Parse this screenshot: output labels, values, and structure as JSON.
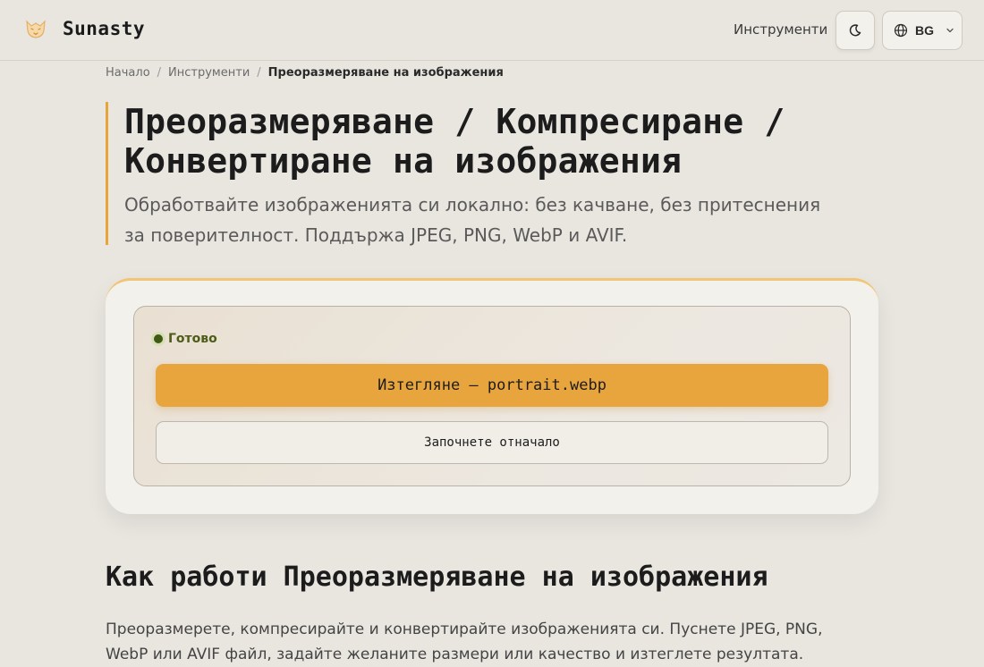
{
  "header": {
    "brand_name": "Sunasty",
    "nav_tools": "Инструменти",
    "language": "BG",
    "icons": {
      "logo": "fox-logo-icon",
      "theme": "moon-icon",
      "language": "globe-icon",
      "dropdown": "chevron-down-icon"
    }
  },
  "breadcrumb": {
    "items": [
      "Начало",
      "Инструменти"
    ],
    "current": "Преоразмеряване на изображения",
    "separator": "/"
  },
  "hero": {
    "title": "Преоразмеряване / Компресиране / Конвертиране на изображения",
    "subtitle": "Обработвайте изображенията си локално: без качване, без притеснения за поверителност. Поддържа JPEG, PNG, WebP и AVIF."
  },
  "tool": {
    "status": "Готово",
    "download_label": "Изтегляне — portrait.webp",
    "restart_label": "Започнете отначало"
  },
  "how": {
    "title": "Как работи Преоразмеряване на изображения",
    "body": "Преоразмерете, компресирайте и конвертирайте изображенията си. Пуснете JPEG, PNG, WebP или AVIF файл, задайте желаните размери или качество и изтеглете резултата."
  },
  "colors": {
    "accent": "#e9a53d",
    "background": "#e9e6e0",
    "status_green": "#3e5a14"
  }
}
